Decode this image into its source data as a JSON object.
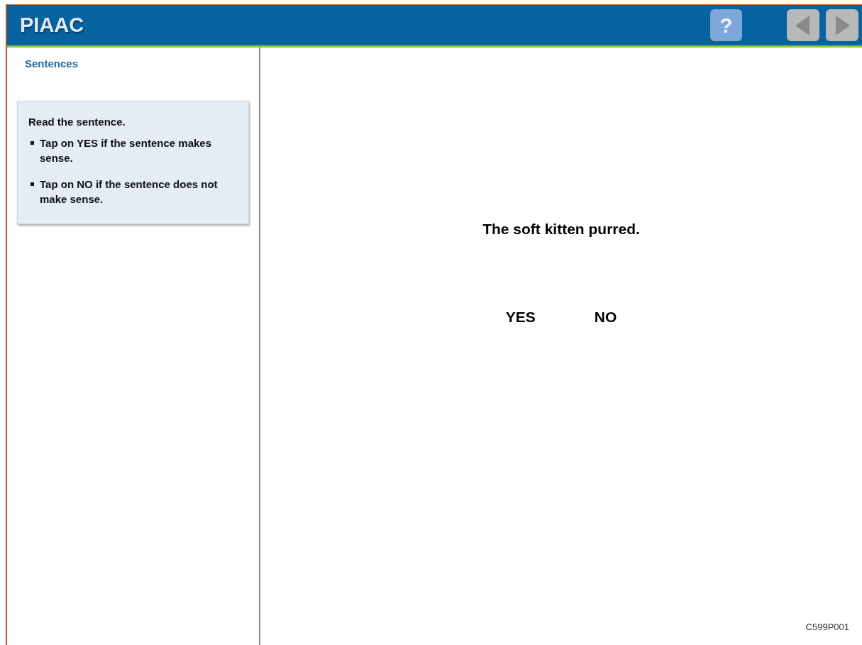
{
  "header": {
    "title": "PIAAC",
    "help_button": {
      "label": "?"
    },
    "nav_buttons": [
      {
        "kind": "back",
        "disabled": true
      },
      {
        "kind": "next",
        "disabled": true
      }
    ]
  },
  "sidebar": {
    "heading": "Sentences",
    "instructions": {
      "intro": "Read the sentence.",
      "bullets": [
        "Tap on YES if the sentence makes sense.",
        "Tap on NO if the sentence does not make sense."
      ]
    }
  },
  "main": {
    "sentence": "The soft kitten purred.",
    "answers": [
      {
        "label": "YES",
        "selected": false
      },
      {
        "label": "NO",
        "selected": false
      }
    ],
    "item_code": "C599P001"
  }
}
